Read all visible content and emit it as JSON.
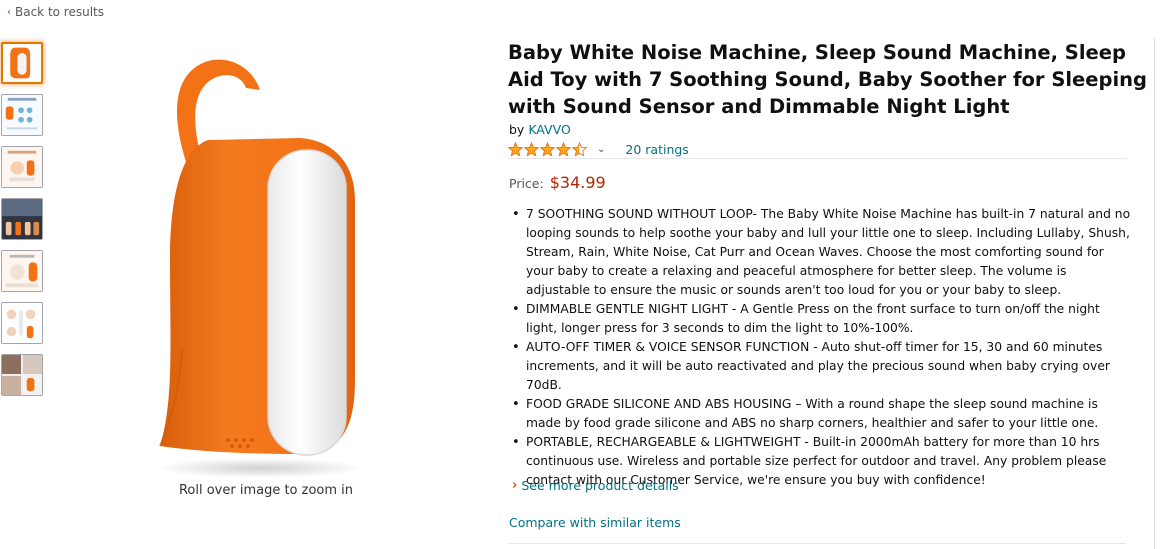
{
  "nav": {
    "back_label": "Back to results"
  },
  "gallery": {
    "thumbnails": [
      "main-product",
      "features-overview",
      "usage-scene",
      "lifestyle-night",
      "timer-function",
      "nursery-scene",
      "family-scene"
    ],
    "selected_index": 0,
    "zoom_hint": "Roll over image to zoom in"
  },
  "product": {
    "title": "Baby White Noise Machine, Sleep Sound Machine, Sleep Aid Toy with 7 Soothing Sound, Baby Soother for Sleeping with Sound Sensor and Dimmable Night Light",
    "by_prefix": "by",
    "brand": "KAVVO",
    "rating_stars": 4.5,
    "ratings_text": "20 ratings",
    "price_label": "Price:",
    "price": "$34.99",
    "bullets": [
      "7 SOOTHING SOUND WITHOUT LOOP- The Baby White Noise Machine has built-in 7 natural and no looping sounds to help soothe your baby and lull your little one to sleep. Including Lullaby, Shush, Stream, Rain, White Noise, Cat Purr and Ocean Waves. Choose the most comforting sound for your baby to create a relaxing and peaceful atmosphere for better sleep. The volume is adjustable to ensure the music or sounds aren't too loud for you or your baby to sleep.",
      "DIMMABLE GENTLE NIGHT LIGHT - A Gentle Press on the front surface to turn on/off the night light, longer press for 3 seconds to dim the light to 10%-100%.",
      "AUTO-OFF TIMER & VOICE SENSOR FUNCTION - Auto shut-off timer for 15, 30 and 60 minutes increments, and it will be auto reactivated and play the precious sound when baby crying over 70dB.",
      "FOOD GRADE SILICONE AND ABS HOUSING – With a round shape the sleep sound machine is made by food grade silicone and ABS no sharp corners, healthier and safer to your little one.",
      "PORTABLE, RECHARGEABLE & LIGHTWEIGHT - Built-in 2000mAh battery for more than 10 hrs continuous use. Wireless and portable size perfect for outdoor and travel. Any problem please contact with our Customer Service, we're ensure you buy with confidence!"
    ],
    "see_more_label": "See more product details",
    "compare_label": "Compare with similar items"
  },
  "colors": {
    "link": "#007185",
    "price": "#b12704",
    "star": "#ffa41c",
    "product_orange": "#f47216",
    "selected_border": "#e77600"
  }
}
